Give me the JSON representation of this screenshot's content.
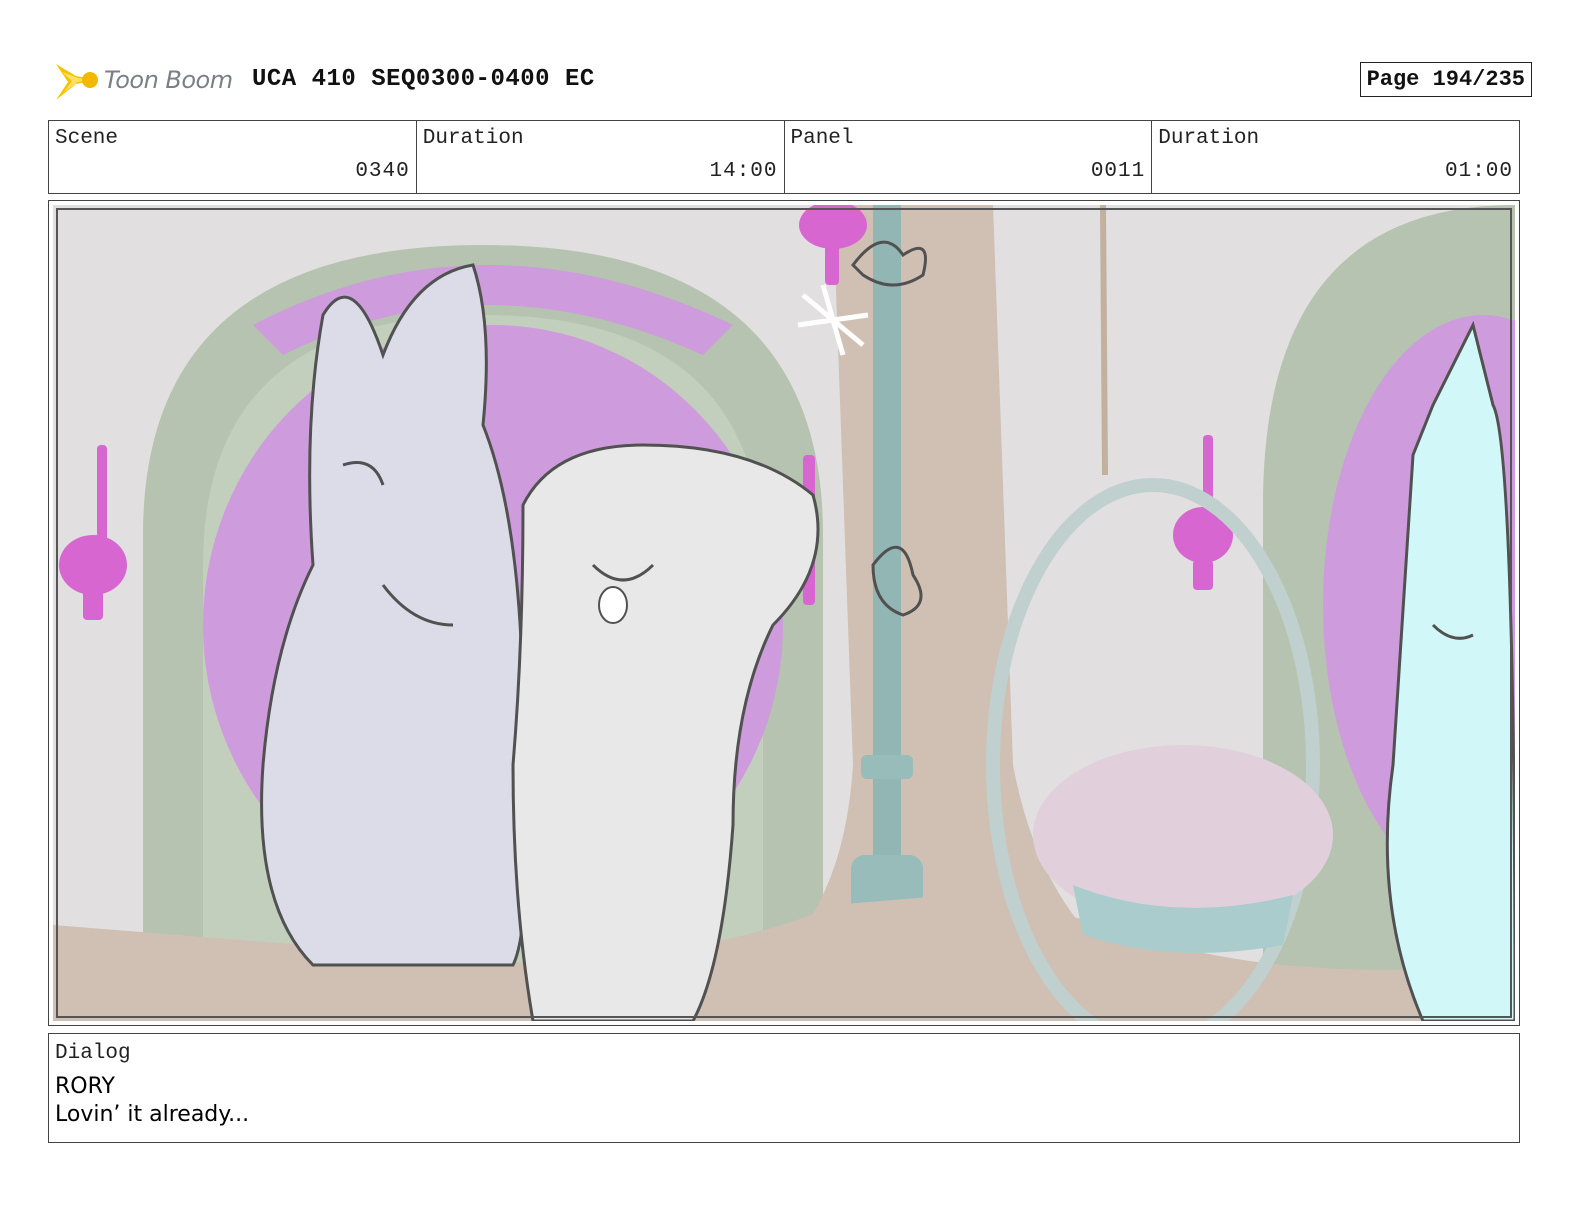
{
  "header": {
    "logo_text": "Toon Boom",
    "title": "UCA 410 SEQ0300-0400 EC",
    "page": "Page 194/235"
  },
  "meta": {
    "scene_label": "Scene",
    "scene_value": "0340",
    "duration_label": "Duration",
    "duration_value": "14:00",
    "panel_label": "Panel",
    "panel_value": "0011",
    "panel_duration_label": "Duration",
    "panel_duration_value": "01:00"
  },
  "dialog": {
    "label": "Dialog",
    "speaker": "RORY",
    "line": "Lovin’ it already..."
  },
  "colors": {
    "logo_yellow": "#f5c400",
    "arch_green": "#a8b9a3",
    "window_purple": "#c68ad6",
    "lamp_magenta": "#d04cc8",
    "pole_teal": "#7faaa6",
    "floor_tan": "#c8b4a6",
    "horse_lavender": "#d6d6e6",
    "unicorn_cyan": "#c9f6f8"
  }
}
